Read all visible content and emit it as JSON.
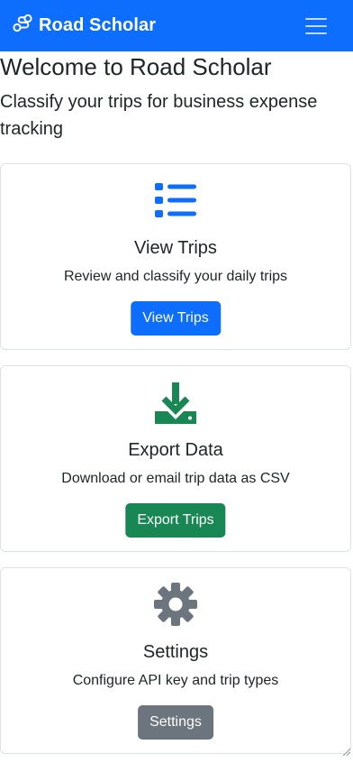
{
  "navbar": {
    "brand": "Road Scholar",
    "brand_icon": "route-icon",
    "toggler_icon": "hamburger-menu-icon"
  },
  "page": {
    "title": "Welcome to Road Scholar",
    "lead": "Classify your trips for business expense tracking"
  },
  "cards": [
    {
      "icon": "list-icon",
      "icon_color": "#0d6efd",
      "title": "View Trips",
      "text": "Review and classify your daily trips",
      "button": "View Trips",
      "button_color": "#0d6efd"
    },
    {
      "icon": "download-icon",
      "icon_color": "#198754",
      "title": "Export Data",
      "text": "Download or email trip data as CSV",
      "button": "Export Trips",
      "button_color": "#198754"
    },
    {
      "icon": "gear-icon",
      "icon_color": "#6c757d",
      "title": "Settings",
      "text": "Configure API key and trip types",
      "button": "Settings",
      "button_color": "#6c757d"
    }
  ]
}
